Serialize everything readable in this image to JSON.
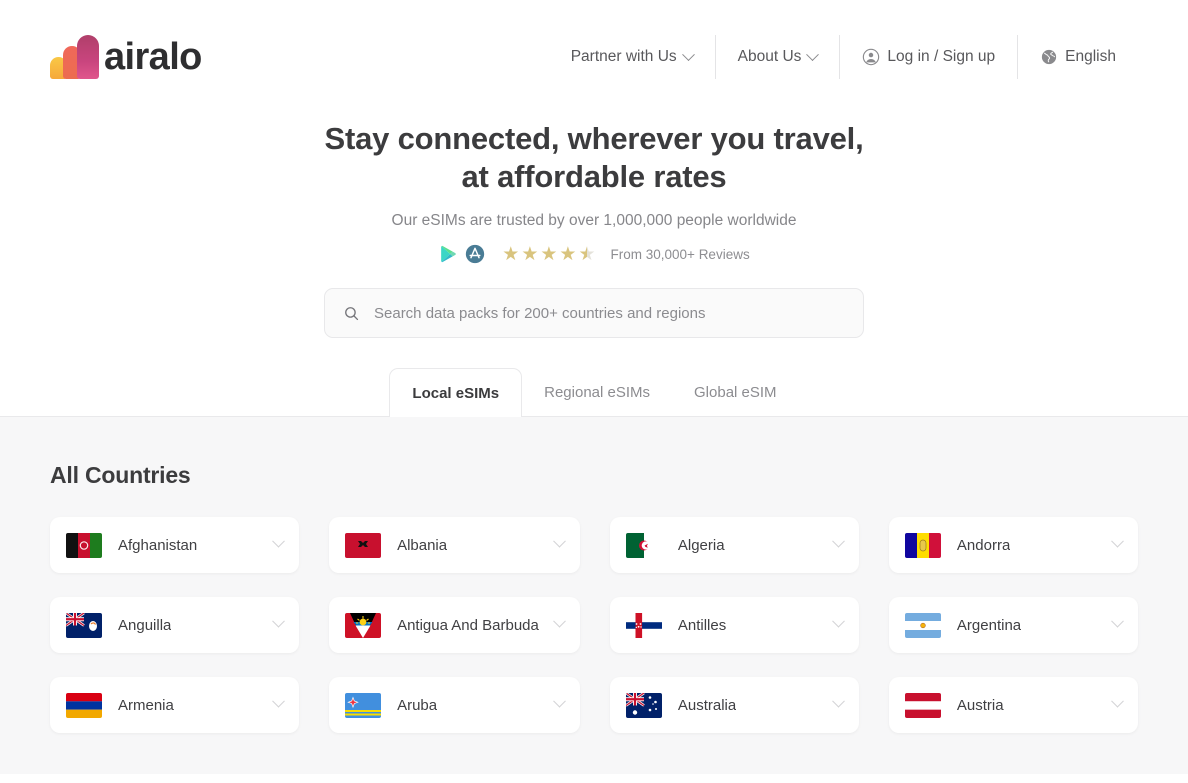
{
  "header": {
    "logo_text": "airalo",
    "nav": [
      {
        "label": "Partner with Us",
        "icon": "",
        "caret": true
      },
      {
        "label": "About Us",
        "icon": "",
        "caret": true
      },
      {
        "label": "Log in / Sign up",
        "icon": "user-circle-icon",
        "caret": false
      },
      {
        "label": "English",
        "icon": "globe-icon",
        "caret": false
      }
    ]
  },
  "hero": {
    "title_line1": "Stay connected, wherever you travel,",
    "title_line2": "at affordable rates",
    "subtitle": "Our eSIMs are trusted by over 1,000,000 people worldwide",
    "rating": {
      "stars_full": 4,
      "stars_half": 1,
      "stars_total": 5,
      "rating_value": 4.5,
      "reviews_label": "From 30,000+ Reviews",
      "store_badges": [
        "google-play-icon",
        "app-store-icon"
      ]
    }
  },
  "search": {
    "placeholder": "Search data packs for 200+ countries and regions",
    "value": "",
    "icon": "search-icon"
  },
  "tabs": [
    {
      "label": "Local eSIMs",
      "active": true
    },
    {
      "label": "Regional eSIMs",
      "active": false
    },
    {
      "label": "Global eSIM",
      "active": false
    }
  ],
  "countries_section": {
    "title": "All Countries",
    "items": [
      {
        "name": "Afghanistan",
        "flag": "af"
      },
      {
        "name": "Albania",
        "flag": "al"
      },
      {
        "name": "Algeria",
        "flag": "dz"
      },
      {
        "name": "Andorra",
        "flag": "ad"
      },
      {
        "name": "Anguilla",
        "flag": "ai"
      },
      {
        "name": "Antigua And Barbuda",
        "flag": "ag"
      },
      {
        "name": "Antilles",
        "flag": "an"
      },
      {
        "name": "Argentina",
        "flag": "ar"
      },
      {
        "name": "Armenia",
        "flag": "am"
      },
      {
        "name": "Aruba",
        "flag": "aw"
      },
      {
        "name": "Australia",
        "flag": "au"
      },
      {
        "name": "Austria",
        "flag": "at"
      }
    ]
  },
  "colors": {
    "brand_pink": "#C9457E",
    "brand_orange": "#EC6D4F",
    "brand_yellow": "#F6A93B",
    "page_bg": "#f7f7f8",
    "text_dark": "#3c3c3e",
    "text_muted": "#8b8b8f",
    "star_gold": "#D9C47E"
  }
}
